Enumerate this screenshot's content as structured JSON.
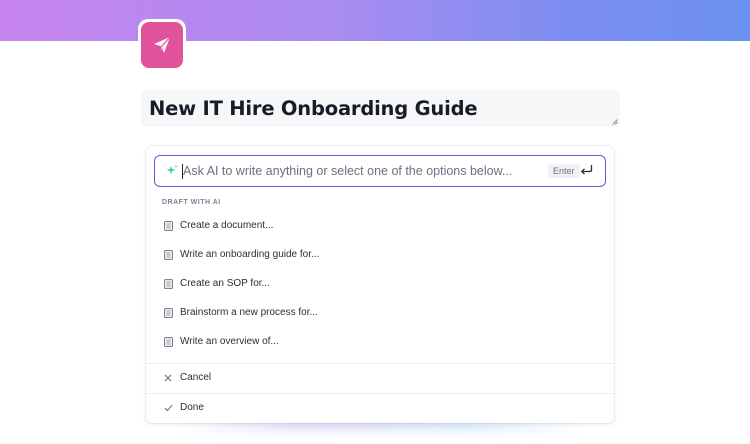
{
  "document": {
    "title": "New IT Hire Onboarding Guide",
    "icon": "paper-plane-icon"
  },
  "ai_prompt": {
    "placeholder": "Ask AI to write anything or select one of the options below...",
    "value": "",
    "enter_label": "Enter",
    "sparkle_icon": "sparkle-icon",
    "submit_icon": "return-icon"
  },
  "draft_section": {
    "label": "DRAFT WITH AI",
    "items": [
      {
        "label": "Create a document...",
        "icon": "document-icon"
      },
      {
        "label": "Write an onboarding guide for...",
        "icon": "document-icon"
      },
      {
        "label": "Create an SOP for...",
        "icon": "document-icon"
      },
      {
        "label": "Brainstorm a new process for...",
        "icon": "document-icon"
      },
      {
        "label": "Write an overview of...",
        "icon": "document-icon"
      }
    ]
  },
  "actions": {
    "cancel_label": "Cancel",
    "done_label": "Done"
  },
  "colors": {
    "banner_start": "#c784ee",
    "banner_end": "#6b90ef",
    "icon_bg": "#e0539a",
    "focus_border": "#5b5fd6",
    "sparkle": "#3cc9a8"
  }
}
